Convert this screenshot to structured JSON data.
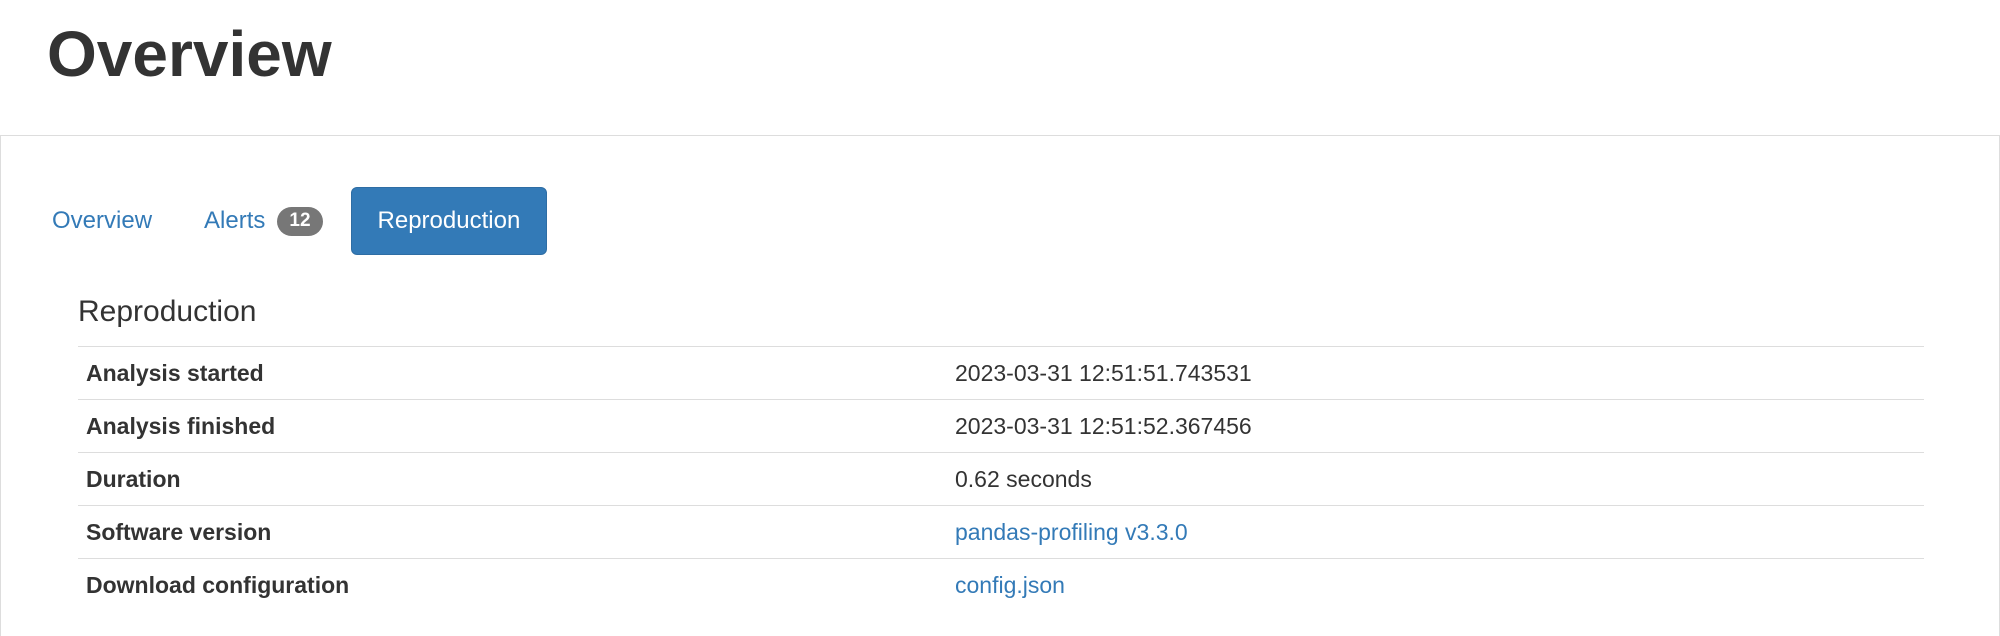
{
  "header": {
    "title": "Overview"
  },
  "tabs": [
    {
      "label": "Overview",
      "active": false
    },
    {
      "label": "Alerts",
      "badge": "12",
      "active": false
    },
    {
      "label": "Reproduction",
      "active": true
    }
  ],
  "reproduction": {
    "title": "Reproduction",
    "rows": [
      {
        "label": "Analysis started",
        "value": "2023-03-31 12:51:51.743531"
      },
      {
        "label": "Analysis finished",
        "value": "2023-03-31 12:51:52.367456"
      },
      {
        "label": "Duration",
        "value": "0.62 seconds"
      },
      {
        "label": "Software version",
        "value": "pandas-profiling v3.3.0"
      },
      {
        "label": "Download configuration",
        "value": "config.json"
      }
    ]
  },
  "colors": {
    "accent": "#337ab7",
    "badge": "#777777",
    "text": "#333333",
    "border": "#dddddd"
  }
}
